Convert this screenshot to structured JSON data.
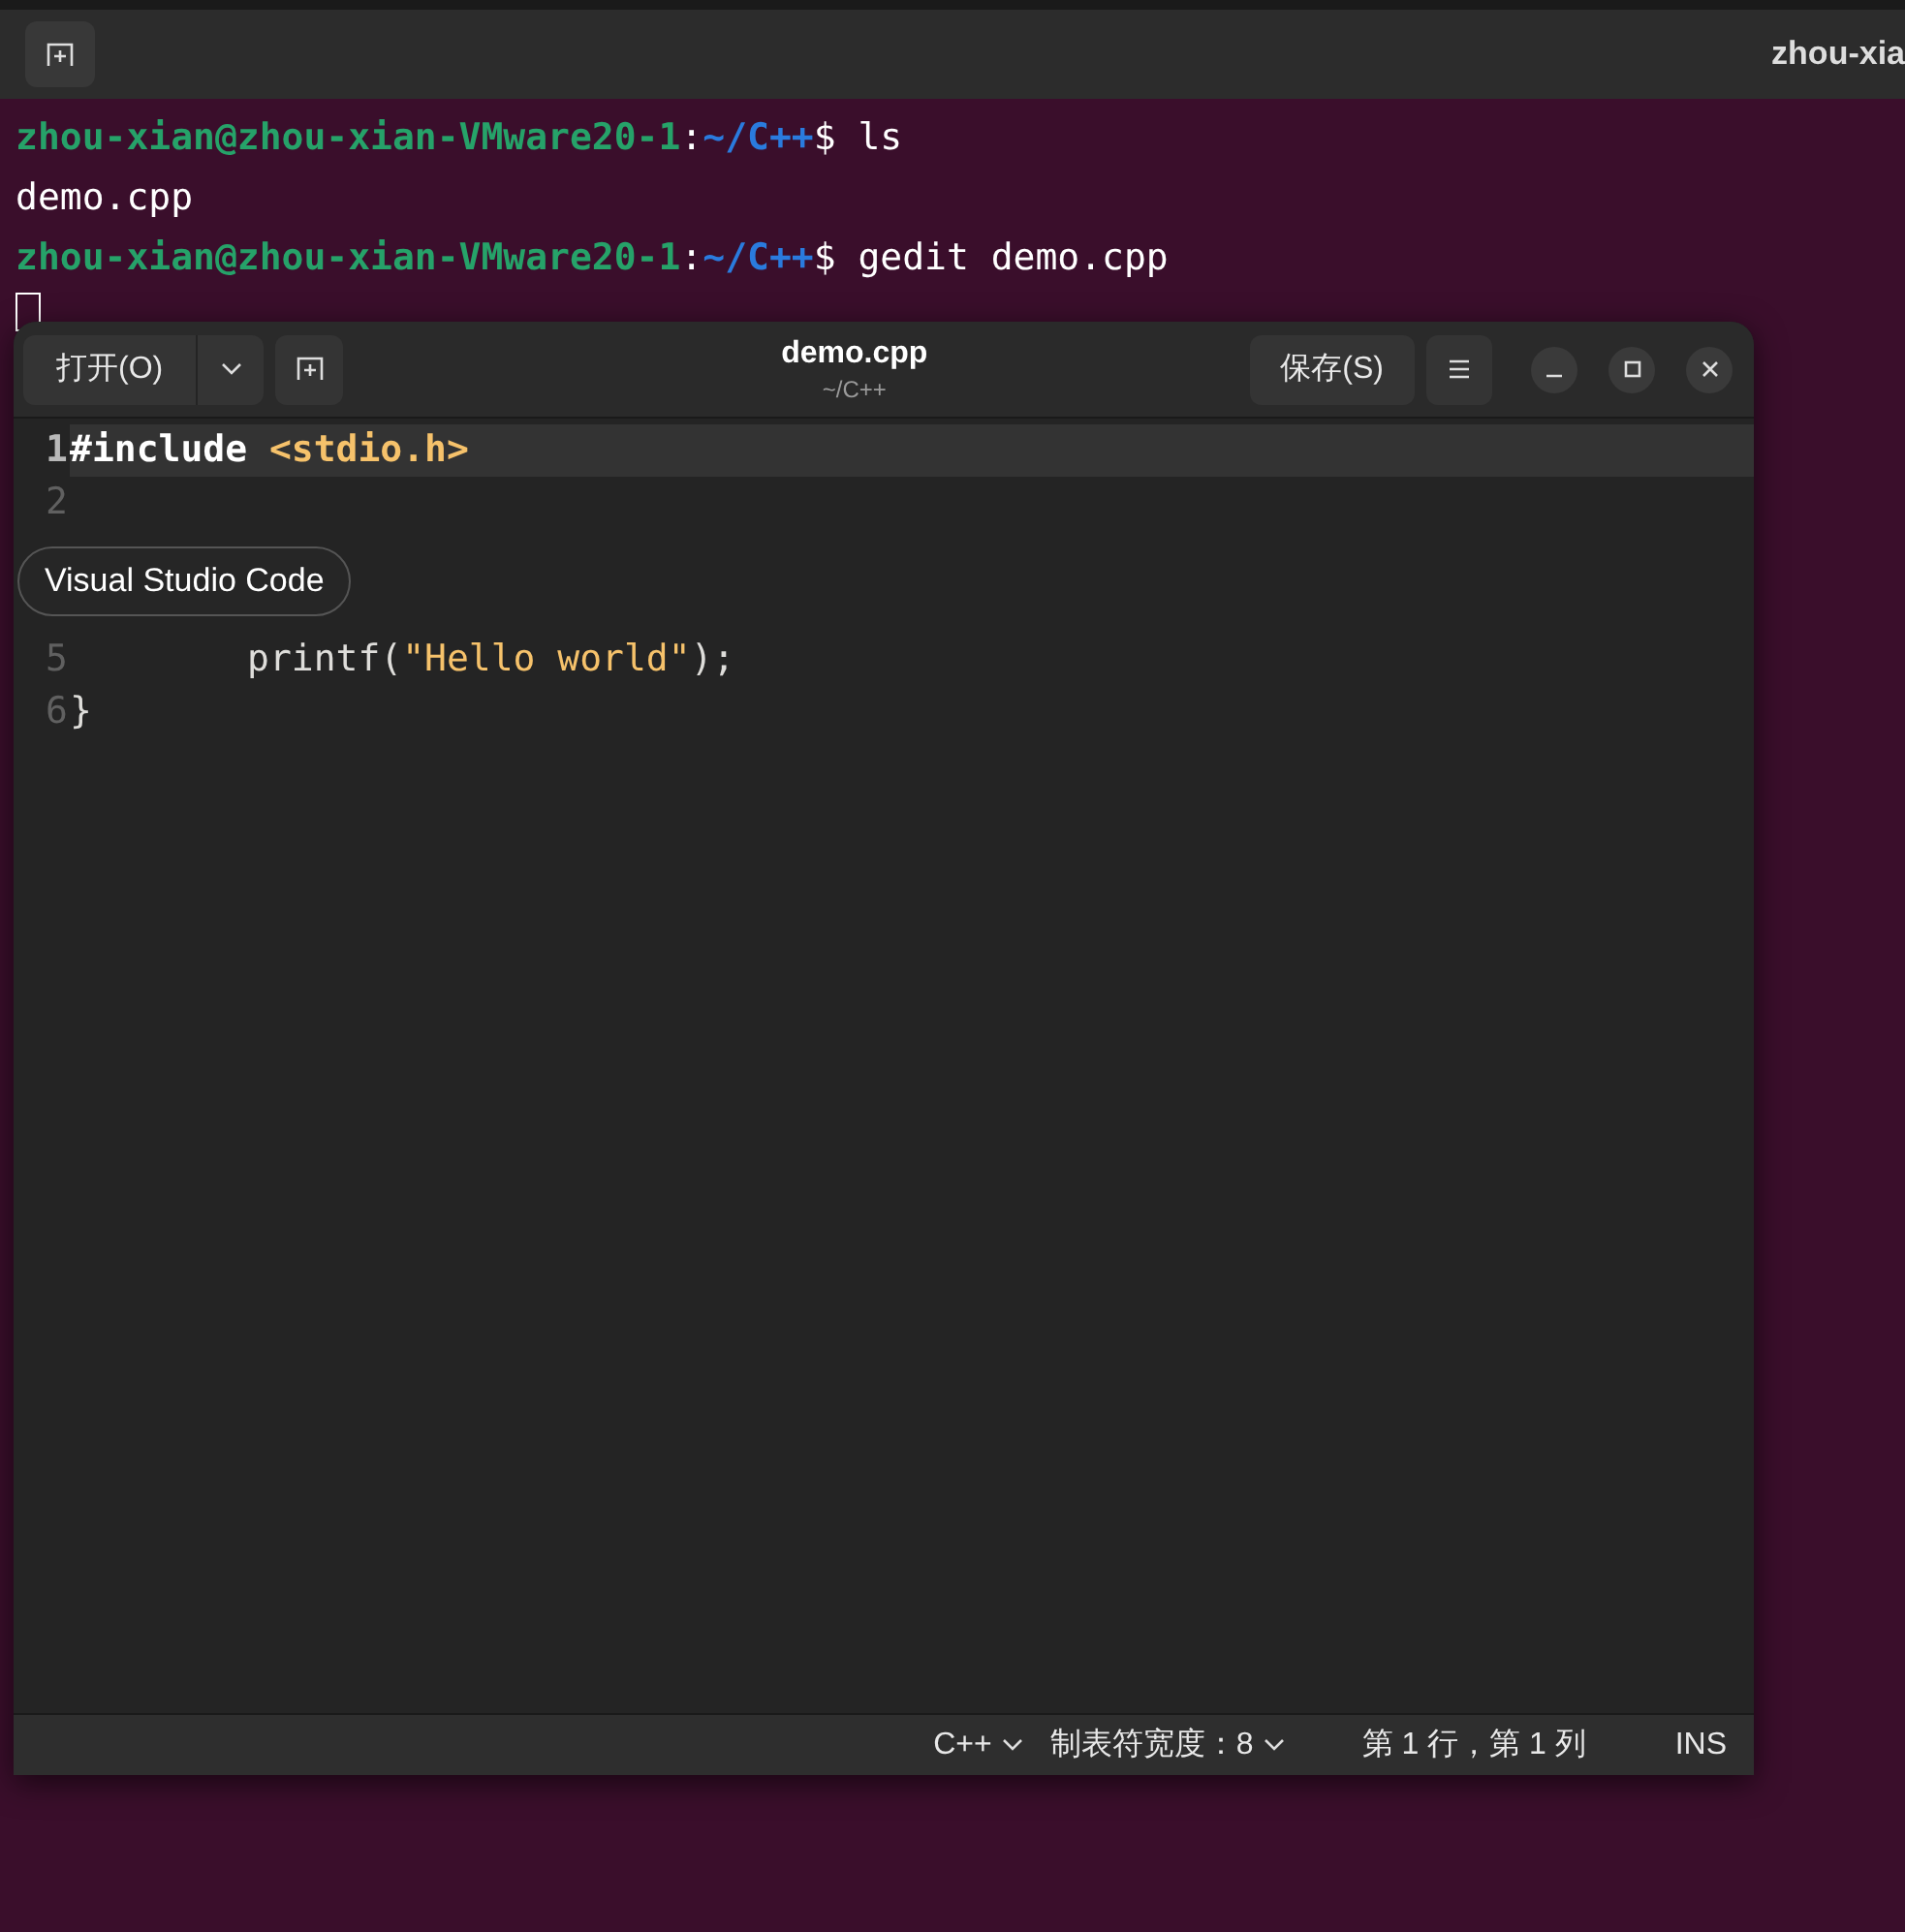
{
  "terminal": {
    "title": "zhou-xia",
    "lines": [
      {
        "segments": [
          {
            "kind": "user",
            "text": "zhou-xian@zhou-xian-VMware20-1"
          },
          {
            "kind": "plain",
            "text": ":"
          },
          {
            "kind": "path",
            "text": "~/C++"
          },
          {
            "kind": "plain",
            "text": "$ ls"
          }
        ]
      },
      {
        "segments": [
          {
            "kind": "plain",
            "text": "demo.cpp"
          }
        ]
      },
      {
        "segments": [
          {
            "kind": "user",
            "text": "zhou-xian@zhou-xian-VMware20-1"
          },
          {
            "kind": "plain",
            "text": ":"
          },
          {
            "kind": "path",
            "text": "~/C++"
          },
          {
            "kind": "plain",
            "text": "$ gedit demo.cpp"
          }
        ]
      }
    ]
  },
  "editor": {
    "title": "demo.cpp",
    "subtitle": "~/C++",
    "open_button": "打开(O)",
    "save_button": "保存(S)",
    "rows": [
      {
        "kind": "line",
        "number": "1",
        "current": true,
        "segments": [
          {
            "kind": "keyword",
            "text": "#include "
          },
          {
            "kind": "header",
            "text": "<stdio.h>"
          }
        ]
      },
      {
        "kind": "line",
        "number": "2",
        "current": false,
        "segments": []
      },
      {
        "kind": "tooltip",
        "text": "Visual Studio Code"
      },
      {
        "kind": "line",
        "number": "5",
        "current": false,
        "segments": [
          {
            "kind": "plain",
            "text": "        printf("
          },
          {
            "kind": "string",
            "text": "\"Hello world\""
          },
          {
            "kind": "plain",
            "text": ");"
          }
        ]
      },
      {
        "kind": "line",
        "number": "6",
        "current": false,
        "segments": [
          {
            "kind": "plain",
            "text": "}"
          }
        ]
      }
    ],
    "status": {
      "language": "C++",
      "tab_width": "制表符宽度：8",
      "position": "第 1 行，第 1 列",
      "mode": "INS"
    }
  }
}
